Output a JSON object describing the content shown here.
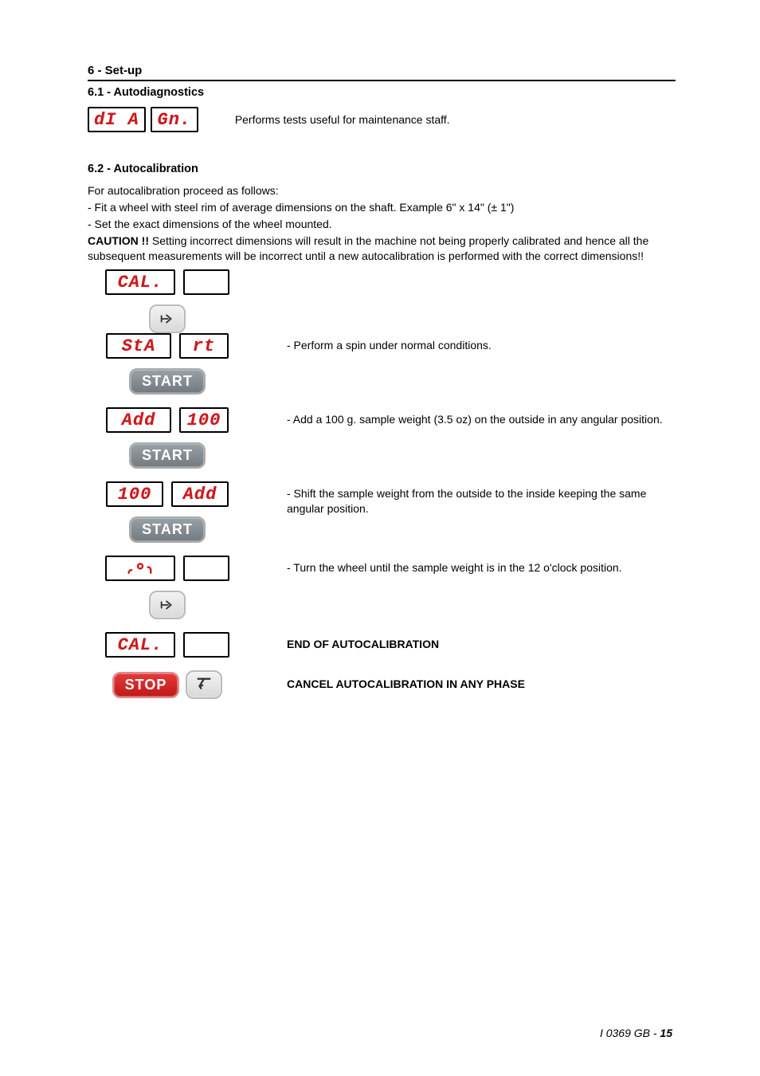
{
  "section6": {
    "title": "6 - Set-up",
    "s61": {
      "title": "6.1 - Autodiagnostics",
      "display_left": "dI A",
      "display_right": "Gn.",
      "text": "Performs tests useful for maintenance staff."
    },
    "s62": {
      "title": "6.2 - Autocalibration",
      "intro1": "For autocalibration proceed as follows:",
      "intro2": "- Fit a wheel with steel rim of average dimensions on the shaft. Example 6\" x 14\" (± 1\")",
      "intro3": "- Set the exact dimensions of the wheel mounted.",
      "caution_label": "CAUTION !!",
      "caution_text": " Setting incorrect dimensions will result in the machine not being properly calibrated and hence all the subsequent measurements will be incorrect until a new autocalibration is performed with the correct dimensions!!",
      "steps": {
        "cal_top": {
          "left": "CAL.",
          "right": ""
        },
        "spin": {
          "left": "StA",
          "right": "rt",
          "desc": "- Perform a spin under normal conditions."
        },
        "add100": {
          "left": "Add",
          "right": "100",
          "desc": "- Add a 100 g. sample weight (3.5 oz) on the outside in any angular position."
        },
        "hundred_add": {
          "left": "100",
          "right": "Add",
          "desc": "- Shift the sample weight from the outside to the inside keeping the same angular position."
        },
        "rotate": {
          "desc": "- Turn the wheel until the sample weight is in the 12 o'clock position."
        },
        "cal_end": {
          "left": "CAL.",
          "right": "",
          "desc": "END OF AUTOCALIBRATION"
        },
        "cancel": {
          "desc": "CANCEL AUTOCALIBRATION IN ANY PHASE"
        }
      },
      "buttons": {
        "start": "START",
        "stop": "STOP"
      }
    }
  },
  "footer": {
    "doc": "I 0369 GB - ",
    "page": "15"
  }
}
